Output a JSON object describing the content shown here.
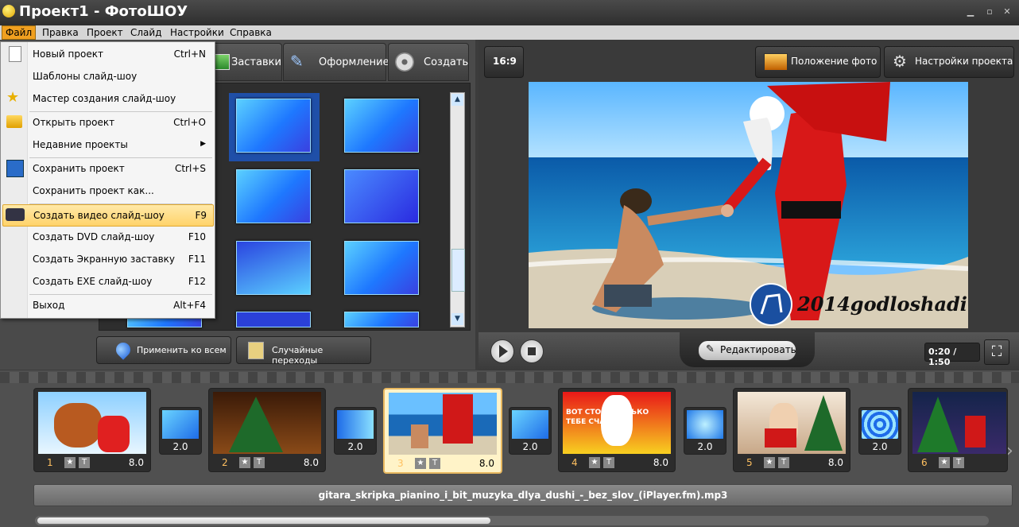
{
  "window": {
    "title": "Проект1 - ФотоШОУ"
  },
  "menu": [
    "Файл",
    "Правка",
    "Проект",
    "Слайд",
    "Настройки",
    "Справка"
  ],
  "tabs": [
    {
      "label": "Заставки",
      "icon": "screensaver-icon"
    },
    {
      "label": "Оформление",
      "icon": "brush-icon"
    },
    {
      "label": "Создать",
      "icon": "film-reel-icon"
    }
  ],
  "file_menu": [
    {
      "label": "Новый проект",
      "shortcut": "Ctrl+N",
      "icon": "new-document-icon"
    },
    {
      "label": "Шаблоны слайд-шоу",
      "shortcut": ""
    },
    {
      "label": "Мастер создания слайд-шоу",
      "shortcut": "",
      "icon": "star-icon"
    },
    {
      "label": "Открыть проект",
      "shortcut": "Ctrl+O",
      "icon": "folder-icon"
    },
    {
      "label": "Недавние проекты",
      "shortcut": "",
      "submenu": true
    },
    {
      "label": "Сохранить проект",
      "shortcut": "Ctrl+S",
      "icon": "floppy-icon"
    },
    {
      "label": "Сохранить проект как...",
      "shortcut": ""
    },
    {
      "label": "Создать видео слайд-шоу",
      "shortcut": "F9",
      "icon": "camera-icon",
      "highlighted": true
    },
    {
      "label": "Создать DVD слайд-шоу",
      "shortcut": "F10"
    },
    {
      "label": "Создать Экранную заставку",
      "shortcut": "F11"
    },
    {
      "label": "Создать EXE слайд-шоу",
      "shortcut": "F12"
    },
    {
      "label": "Выход",
      "shortcut": "Alt+F4"
    }
  ],
  "transitions_panel": {
    "apply_all": "Применить ко всем",
    "random": "Случайные переходы"
  },
  "right_toolbar": {
    "aspect": "16:9",
    "photo_position": "Положение фото",
    "project_settings": "Настройки проекта"
  },
  "preview": {
    "watermark": "2014godloshadi"
  },
  "player": {
    "edit": "Редактировать",
    "time": "0:20 / 1:50"
  },
  "slides": [
    {
      "num": "1",
      "duration": "8.0"
    },
    {
      "num": "2",
      "duration": "8.0"
    },
    {
      "num": "3",
      "duration": "8.0",
      "selected": true
    },
    {
      "num": "4",
      "duration": "8.0"
    },
    {
      "num": "5",
      "duration": "8.0"
    },
    {
      "num": "6",
      "duration": "8.0"
    }
  ],
  "transitions": [
    "2.0",
    "2.0",
    "2.0",
    "2.0",
    "2.0"
  ],
  "slide4_text": "ВОТ СТОООООЛЬКО ТЕБЕ СЧАСТЬЯ",
  "music_track": "gitara_skripka_pianino_i_bit_muzyka_dlya_dushi_-_bez_slov_(iPlayer.fm).mp3",
  "colors": {
    "accent": "#f0a020",
    "highlight": "#ffd36a",
    "selected_slide": "#fff3c8"
  }
}
